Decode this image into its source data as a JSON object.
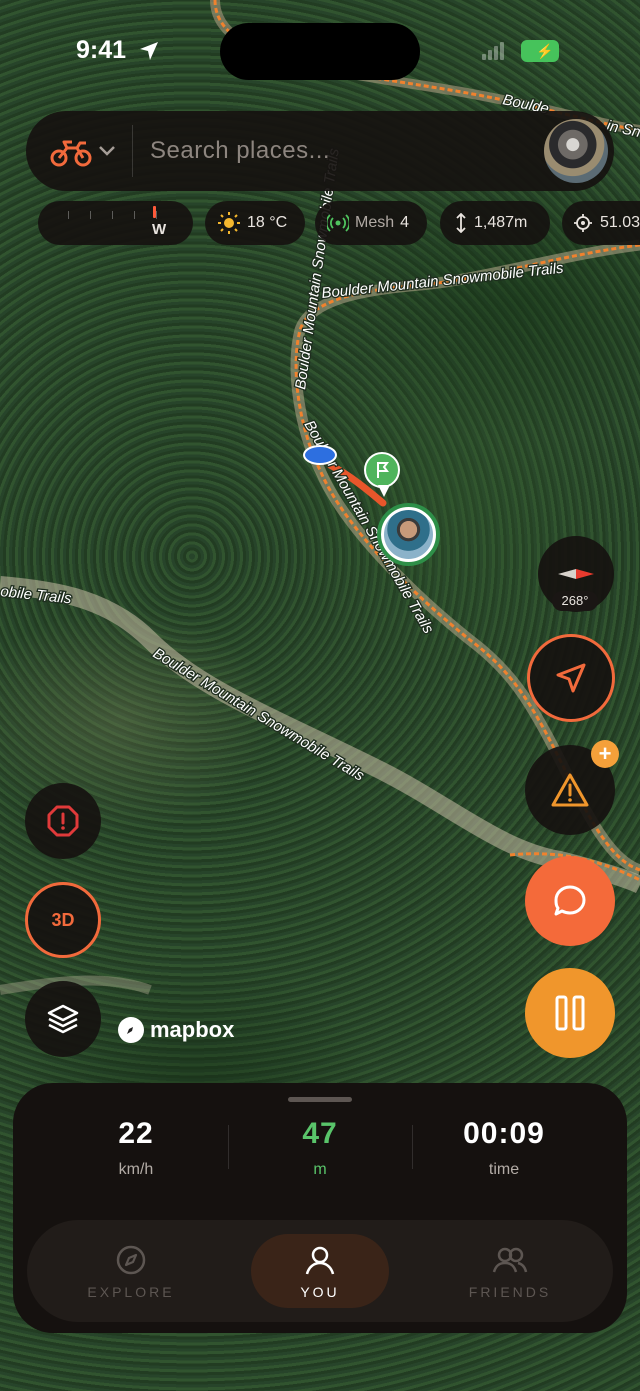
{
  "status_bar": {
    "time": "9:41",
    "battery_icon": "charging-battery-icon",
    "battery_color": "#46c35b"
  },
  "search": {
    "placeholder": "Search places...",
    "vehicle_icon": "motorcycle-icon",
    "accent": "#f26a3c"
  },
  "chips": {
    "compass_direction": "W",
    "temperature": "18 °C",
    "mesh_label": "Mesh",
    "mesh_count": "4",
    "altitude": "1,487m",
    "coordinate": "51.03"
  },
  "map": {
    "trail_labels": [
      "Boulder Mountain Snowmobile Trails",
      "Boulder Mountain Snowmobile Trails",
      "Boulder Mountain Snowmobile Trails",
      "Boulder Mountain Snowmobile Trails",
      "obile Trails"
    ],
    "top_trail_partial": "Boulde",
    "top_trail_partial_right": "in Sn",
    "attribution": "mapbox"
  },
  "controls": {
    "compass_heading": "268°",
    "three_d_label": "3D"
  },
  "stats": [
    {
      "value": "22",
      "unit": "km/h"
    },
    {
      "value": "47",
      "unit": "m"
    },
    {
      "value": "00:09",
      "unit": "time"
    }
  ],
  "tabs": [
    {
      "label": "EXPLORE",
      "icon": "compass-icon",
      "active": false
    },
    {
      "label": "YOU",
      "icon": "person-icon",
      "active": true
    },
    {
      "label": "FRIENDS",
      "icon": "friends-icon",
      "active": false
    }
  ],
  "colors": {
    "orange": "#f46a3a",
    "amber": "#f0962c",
    "green": "#59c46a",
    "panel": "#15110f"
  }
}
